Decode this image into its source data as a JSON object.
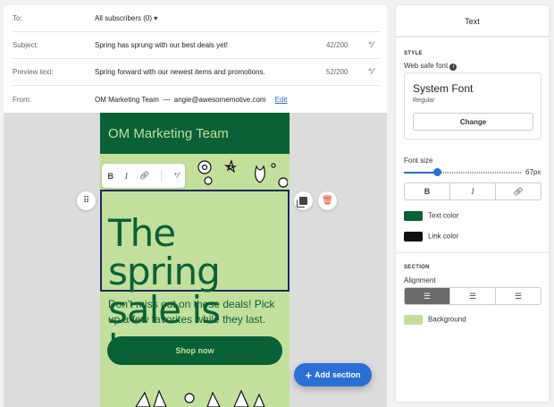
{
  "header": {
    "to": {
      "label": "To:",
      "value": "All subscribers (0)"
    },
    "subject": {
      "label": "Subject:",
      "value": "Spring has sprung with our best deals yet!",
      "count": "42/200"
    },
    "preview": {
      "label": "Preview text:",
      "value": "Spring forward with our newest items and promotions.",
      "count": "52/200"
    },
    "from": {
      "label": "From:",
      "value": "OM Marketing Team  —  angie@awesomemotive.com",
      "edit": "Edit"
    }
  },
  "email": {
    "brand": "OM Marketing Team",
    "headline": "The spring sale is here",
    "paragraph": "Don't miss out on these deals! Pick up a few favorites while they last.",
    "button": "Shop now",
    "colors": {
      "header": "#0b6137",
      "background": "#c3df9c"
    }
  },
  "toolbar": {
    "bold": "B",
    "italic": "I"
  },
  "add_section": "Add section",
  "panel": {
    "title": "Text",
    "style_heading": "STYLE",
    "font_label": "Web safe font",
    "font_name": "System Font",
    "font_weight": "Regular",
    "change": "Change",
    "font_size_label": "Font size",
    "font_size_value": "67px",
    "font_size_fraction": 0.28,
    "bold": "B",
    "italic": "I",
    "text_color_label": "Text color",
    "text_color": "#0b6137",
    "link_color_label": "Link color",
    "link_color": "#111111",
    "section_heading": "SECTION",
    "alignment_label": "Alignment",
    "alignment_selected": "left",
    "background_label": "Background",
    "background_color": "#c3df9c"
  }
}
